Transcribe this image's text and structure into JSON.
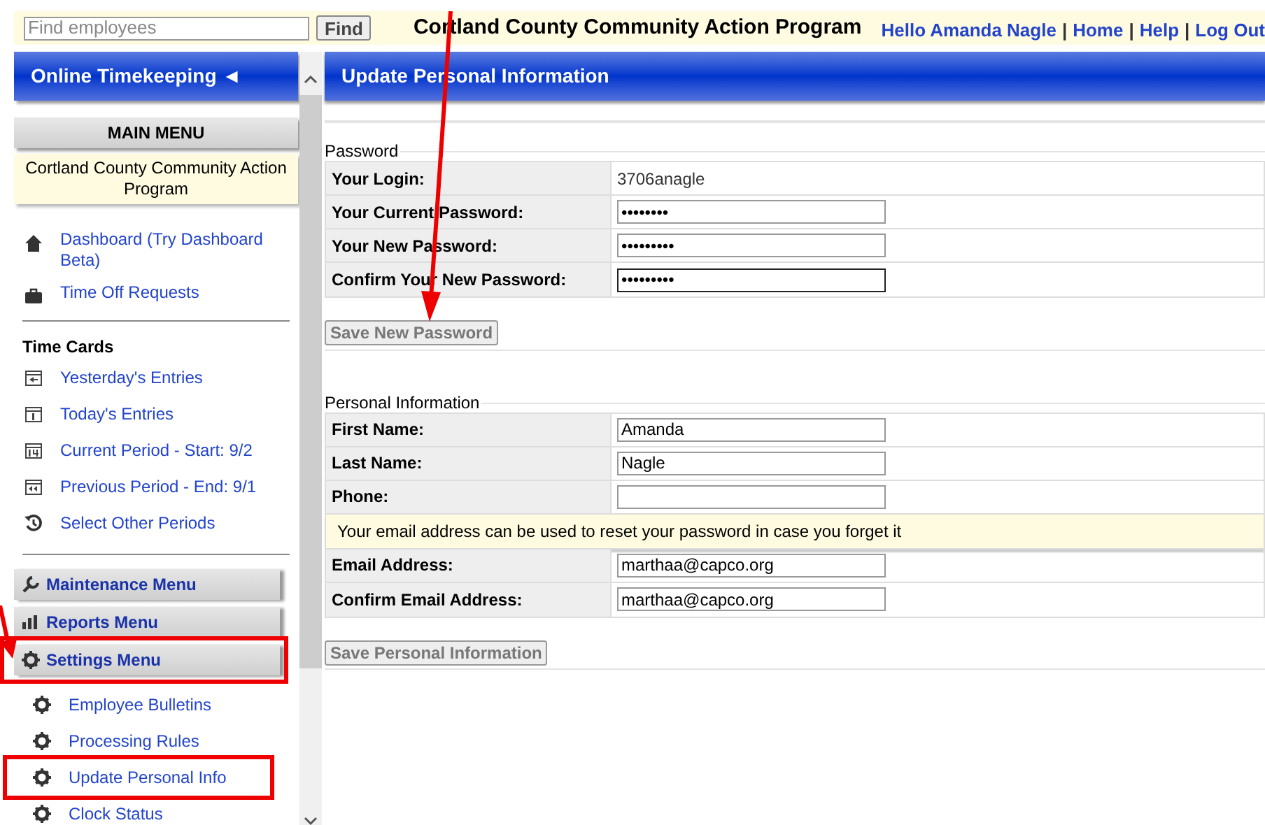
{
  "top_bar": {
    "search": {
      "placeholder": "Find employees"
    },
    "find_button": "Find",
    "title": "Cortland County Community Action Program",
    "links": [
      "Hello Amanda Nagle",
      "Home",
      "Help",
      "Log Out"
    ],
    "separator": "|"
  },
  "sidebar": {
    "header": "Online Timekeeping ◄",
    "main_menu": "MAIN MENU",
    "organization": "Cortland County Community Action Program",
    "links": [
      {
        "label": "Dashboard (Try Dashboard Beta)",
        "kind": "home"
      },
      {
        "label": "Time Off Requests",
        "kind": "briefcase"
      }
    ],
    "time_cards": {
      "heading": "Time Cards",
      "items": [
        {
          "label": "Yesterday's Entries",
          "kind": "yesterday"
        },
        {
          "label": "Today's Entries",
          "kind": "today"
        },
        {
          "label": "Current Period - Start: 9/2",
          "kind": "current"
        },
        {
          "label": "Previous Period - End: 9/1",
          "kind": "previous"
        },
        {
          "label": "Select Other Periods",
          "kind": "history"
        }
      ]
    },
    "menus": [
      {
        "label": "Maintenance Menu",
        "kind": "maintenance",
        "highlighted": false
      },
      {
        "label": "Reports Menu",
        "kind": "reports",
        "highlighted": false
      },
      {
        "label": "Settings Menu",
        "kind": "settings",
        "highlighted": true
      }
    ],
    "settings_items": [
      {
        "label": "Employee Bulletins",
        "highlighted": false
      },
      {
        "label": "Processing Rules",
        "highlighted": false
      },
      {
        "label": "Update Personal Info",
        "highlighted": true
      },
      {
        "label": "Clock Status",
        "highlighted": false
      }
    ]
  },
  "main": {
    "title": "Update Personal Information",
    "password": {
      "legend": "Password",
      "rows": [
        {
          "label": "Your Login:",
          "kind": "text",
          "value": "3706anagle"
        },
        {
          "label": "Your Current Password:",
          "kind": "input",
          "value": "••••••••",
          "focused": false
        },
        {
          "label": "Your New Password:",
          "kind": "input",
          "value": "•••••••••",
          "focused": false
        },
        {
          "label": "Confirm Your New Password:",
          "kind": "input",
          "value": "•••••••••",
          "focused": true
        }
      ],
      "button": "Save New Password"
    },
    "personal": {
      "legend": "Personal Information",
      "rows": [
        {
          "label": "First Name:",
          "kind": "input",
          "value": "Amanda"
        },
        {
          "label": "Last Name:",
          "kind": "input",
          "value": "Nagle"
        },
        {
          "label": "Phone:",
          "kind": "input",
          "value": ""
        },
        {
          "kind": "note",
          "text": "Your email address can be used to reset your password in case you forget it"
        },
        {
          "label": "Email Address:",
          "kind": "input",
          "value": "marthaa@capco.org"
        },
        {
          "label": "Confirm Email Address:",
          "kind": "input",
          "value": "marthaa@capco.org"
        }
      ],
      "button": "Save Personal Information"
    }
  }
}
